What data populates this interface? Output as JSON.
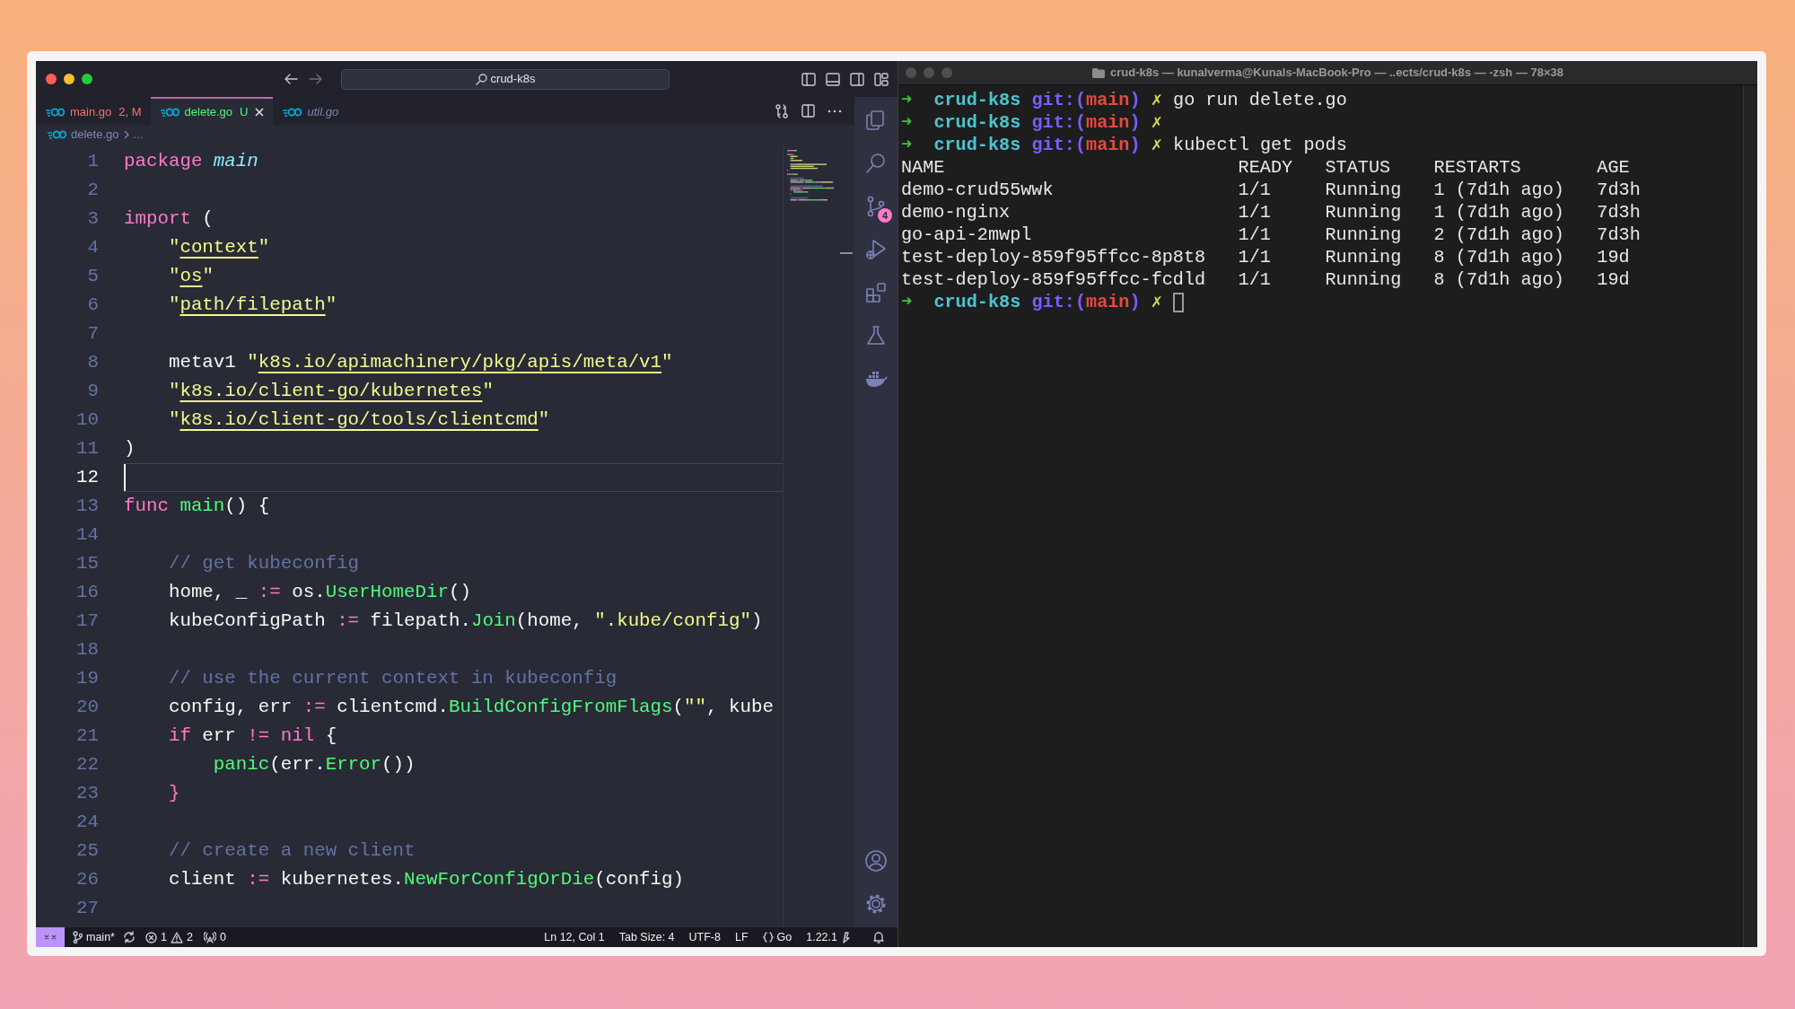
{
  "editor": {
    "title_bar": {
      "search": "crud-k8s"
    },
    "tabs": [
      {
        "label": "main.go",
        "status": "2, M",
        "kind": "modified",
        "selected": false
      },
      {
        "label": "delete.go",
        "status": "U",
        "kind": "untracked",
        "selected": true
      },
      {
        "label": "util.go",
        "kind": "preview",
        "selected": false
      }
    ],
    "breadcrumb": [
      "delete.go",
      "..."
    ],
    "code_lines": [
      {
        "number": "1",
        "current": false,
        "tokens": [
          {
            "kind": "kw",
            "text": "package "
          },
          {
            "kind": "pkg",
            "text": "main"
          }
        ]
      },
      {
        "number": "2",
        "current": false
      },
      {
        "number": "3",
        "current": false,
        "tokens": [
          {
            "kind": "kw",
            "text": "import"
          },
          {
            "kind": "plain",
            "text": " ("
          }
        ]
      },
      {
        "number": "4",
        "current": false,
        "tokens": [
          {
            "kind": "str",
            "text": "    \""
          },
          {
            "kind": "path",
            "text": "context"
          },
          {
            "kind": "str",
            "text": "\""
          }
        ]
      },
      {
        "number": "5",
        "current": false,
        "tokens": [
          {
            "kind": "str",
            "text": "    \""
          },
          {
            "kind": "path",
            "text": "os"
          },
          {
            "kind": "str",
            "text": "\""
          }
        ]
      },
      {
        "number": "6",
        "current": false,
        "tokens": [
          {
            "kind": "str",
            "text": "    \""
          },
          {
            "kind": "path",
            "text": "path/filepath"
          },
          {
            "kind": "str",
            "text": "\""
          }
        ]
      },
      {
        "number": "7",
        "current": false
      },
      {
        "number": "8",
        "current": false,
        "tokens": [
          {
            "kind": "plain",
            "text": "    metav1 "
          },
          {
            "kind": "str",
            "text": "\""
          },
          {
            "kind": "path",
            "text": "k8s.io/apimachinery/pkg/apis/meta/v1"
          },
          {
            "kind": "str",
            "text": "\""
          }
        ]
      },
      {
        "number": "9",
        "current": false,
        "tokens": [
          {
            "kind": "str",
            "text": "    \""
          },
          {
            "kind": "path",
            "text": "k8s.io/client-go/kubernetes"
          },
          {
            "kind": "str",
            "text": "\""
          }
        ]
      },
      {
        "number": "10",
        "current": false,
        "tokens": [
          {
            "kind": "str",
            "text": "    \""
          },
          {
            "kind": "path",
            "text": "k8s.io/client-go/tools/clientcmd"
          },
          {
            "kind": "str",
            "text": "\""
          }
        ]
      },
      {
        "number": "11",
        "current": false,
        "tokens": [
          {
            "kind": "plain",
            "text": ")"
          }
        ]
      },
      {
        "number": "12",
        "current": true
      },
      {
        "number": "13",
        "current": false,
        "tokens": [
          {
            "kind": "kw",
            "text": "func "
          },
          {
            "kind": "fn",
            "text": "main"
          },
          {
            "kind": "plain",
            "text": "() {"
          }
        ]
      },
      {
        "number": "14",
        "current": false
      },
      {
        "number": "15",
        "current": false,
        "tokens": [
          {
            "kind": "comment",
            "text": "    // get kubeconfig"
          }
        ]
      },
      {
        "number": "16",
        "current": false,
        "tokens": [
          {
            "kind": "plain",
            "text": "    home, _ "
          },
          {
            "kind": "kw",
            "text": ":="
          },
          {
            "kind": "plain",
            "text": " os."
          },
          {
            "kind": "fn",
            "text": "UserHomeDir"
          },
          {
            "kind": "plain",
            "text": "()"
          }
        ]
      },
      {
        "number": "17",
        "current": false,
        "tokens": [
          {
            "kind": "plain",
            "text": "    kubeConfigPath "
          },
          {
            "kind": "kw",
            "text": ":="
          },
          {
            "kind": "plain",
            "text": " filepath."
          },
          {
            "kind": "fn",
            "text": "Join"
          },
          {
            "kind": "plain",
            "text": "(home, "
          },
          {
            "kind": "str",
            "text": "\".kube/config\""
          },
          {
            "kind": "plain",
            "text": ")"
          }
        ]
      },
      {
        "number": "18",
        "current": false
      },
      {
        "number": "19",
        "current": false,
        "tokens": [
          {
            "kind": "comment",
            "text": "    // use the current context in kubeconfig"
          }
        ]
      },
      {
        "number": "20",
        "current": false,
        "tokens": [
          {
            "kind": "plain",
            "text": "    config, err "
          },
          {
            "kind": "kw",
            "text": ":="
          },
          {
            "kind": "plain",
            "text": " clientcmd."
          },
          {
            "kind": "fn",
            "text": "BuildConfigFromFlags"
          },
          {
            "kind": "plain",
            "text": "("
          },
          {
            "kind": "str",
            "text": "\"\""
          },
          {
            "kind": "plain",
            "text": ", kube"
          }
        ]
      },
      {
        "number": "21",
        "current": false,
        "tokens": [
          {
            "kind": "kw",
            "text": "    if"
          },
          {
            "kind": "plain",
            "text": " err "
          },
          {
            "kind": "kw",
            "text": "!= nil"
          },
          {
            "kind": "plain",
            "text": " {"
          }
        ]
      },
      {
        "number": "22",
        "current": false,
        "tokens": [
          {
            "kind": "fn",
            "text": "        panic"
          },
          {
            "kind": "plain",
            "text": "(err."
          },
          {
            "kind": "fn",
            "text": "Error"
          },
          {
            "kind": "plain",
            "text": "())"
          }
        ]
      },
      {
        "number": "23",
        "current": false,
        "tokens": [
          {
            "kind": "kw",
            "text": "    }"
          }
        ]
      },
      {
        "number": "24",
        "current": false
      },
      {
        "number": "25",
        "current": false,
        "tokens": [
          {
            "kind": "comment",
            "text": "    // create a new client"
          }
        ]
      },
      {
        "number": "26",
        "current": false,
        "tokens": [
          {
            "kind": "plain",
            "text": "    client "
          },
          {
            "kind": "kw",
            "text": ":="
          },
          {
            "kind": "plain",
            "text": " kubernetes."
          },
          {
            "kind": "fn",
            "text": "NewForConfigOrDie"
          },
          {
            "kind": "plain",
            "text": "(config)"
          }
        ]
      },
      {
        "number": "27",
        "current": false
      }
    ],
    "activity_bar": [
      {
        "kind": "files"
      },
      {
        "kind": "search"
      },
      {
        "kind": "source-control",
        "badge": "4"
      },
      {
        "kind": "run"
      },
      {
        "kind": "extensions"
      },
      {
        "kind": "testing"
      },
      {
        "kind": "docker"
      }
    ],
    "activity_bar_bottom": [
      {
        "kind": "account"
      },
      {
        "kind": "settings"
      }
    ],
    "status_bar": {
      "branch": "main*",
      "errors": "1",
      "warnings": "2",
      "ports": "0",
      "position": "Ln 12, Col 1",
      "tab_size": "Tab Size: 4",
      "encoding": "UTF-8",
      "eol": "LF",
      "language": "Go",
      "version": "1.22.1"
    }
  },
  "terminal": {
    "title": "crud-k8s — kunalverma@Kunals-MacBook-Pro — ..ects/crud-k8s — -zsh — 78×38",
    "lines": [
      {
        "kind": "prompt",
        "arrow": "➜",
        "dir": "crud-k8s",
        "git": "git:(",
        "branch": "main",
        "close": ")",
        "dirty": "✗",
        "command": "go run delete.go",
        "cursor": false
      },
      {
        "kind": "prompt",
        "arrow": "➜",
        "dir": "crud-k8s",
        "git": "git:(",
        "branch": "main",
        "close": ")",
        "dirty": "✗",
        "cursor": false
      },
      {
        "kind": "prompt",
        "arrow": "➜",
        "dir": "crud-k8s",
        "git": "git:(",
        "branch": "main",
        "close": ")",
        "dirty": "✗",
        "command": "kubectl get pods",
        "cursor": false
      },
      {
        "kind": "table",
        "columns": [
          "NAME",
          "READY",
          "STATUS",
          "RESTARTS",
          "AGE"
        ],
        "rows": [
          [
            "demo-crud55wwk",
            "1/1",
            "Running",
            "1 (7d1h ago)",
            "7d3h"
          ],
          [
            "demo-nginx",
            "1/1",
            "Running",
            "1 (7d1h ago)",
            "7d3h"
          ],
          [
            "go-api-2mwpl",
            "1/1",
            "Running",
            "2 (7d1h ago)",
            "7d3h"
          ],
          [
            "test-deploy-859f95ffcc-8p8t8",
            "1/1",
            "Running",
            "8 (7d1h ago)",
            "19d"
          ],
          [
            "test-deploy-859f95ffcc-fcdld",
            "1/1",
            "Running",
            "8 (7d1h ago)",
            "19d"
          ]
        ]
      },
      {
        "kind": "prompt",
        "arrow": "➜",
        "dir": "crud-k8s",
        "git": "git:(",
        "branch": "main",
        "close": ")",
        "dirty": "✗",
        "cursor": true
      }
    ]
  }
}
